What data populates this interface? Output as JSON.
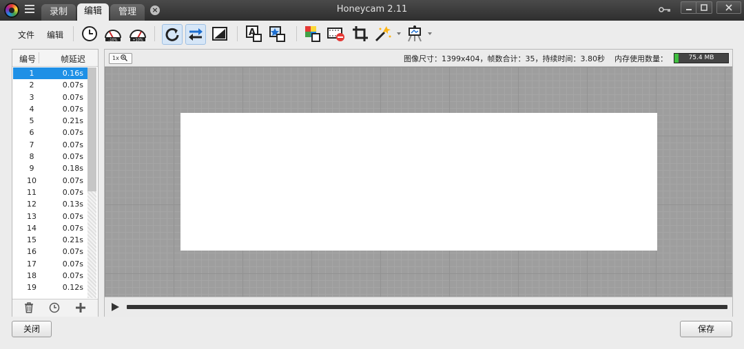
{
  "app": {
    "title": "Honeycam 2.11"
  },
  "tabs": [
    {
      "label": "录制"
    },
    {
      "label": "编辑"
    },
    {
      "label": "管理"
    }
  ],
  "toolbar": {
    "file_label": "文件",
    "edit_label": "编辑"
  },
  "frame_list": {
    "header_number": "编号",
    "header_delay": "帧延迟",
    "selected_index": 0,
    "rows": [
      {
        "n": "1",
        "d": "0.16s"
      },
      {
        "n": "2",
        "d": "0.07s"
      },
      {
        "n": "3",
        "d": "0.07s"
      },
      {
        "n": "4",
        "d": "0.07s"
      },
      {
        "n": "5",
        "d": "0.21s"
      },
      {
        "n": "6",
        "d": "0.07s"
      },
      {
        "n": "7",
        "d": "0.07s"
      },
      {
        "n": "8",
        "d": "0.07s"
      },
      {
        "n": "9",
        "d": "0.18s"
      },
      {
        "n": "10",
        "d": "0.07s"
      },
      {
        "n": "11",
        "d": "0.07s"
      },
      {
        "n": "12",
        "d": "0.13s"
      },
      {
        "n": "13",
        "d": "0.07s"
      },
      {
        "n": "14",
        "d": "0.07s"
      },
      {
        "n": "15",
        "d": "0.21s"
      },
      {
        "n": "16",
        "d": "0.07s"
      },
      {
        "n": "17",
        "d": "0.07s"
      },
      {
        "n": "18",
        "d": "0.07s"
      },
      {
        "n": "19",
        "d": "0.12s"
      }
    ]
  },
  "info": {
    "zoom": "1x",
    "summary": "图像尺寸：1399x404，帧数合计：35，持续时间：3.80秒",
    "memory_label": "内存使用数量：",
    "memory_value": "75.4 MB",
    "memory_fill_fraction": 0.08
  },
  "buttons": {
    "close": "关闭",
    "save": "保存"
  },
  "colors": {
    "accent": "#1e90e6",
    "memory": "#3fbf3f"
  }
}
